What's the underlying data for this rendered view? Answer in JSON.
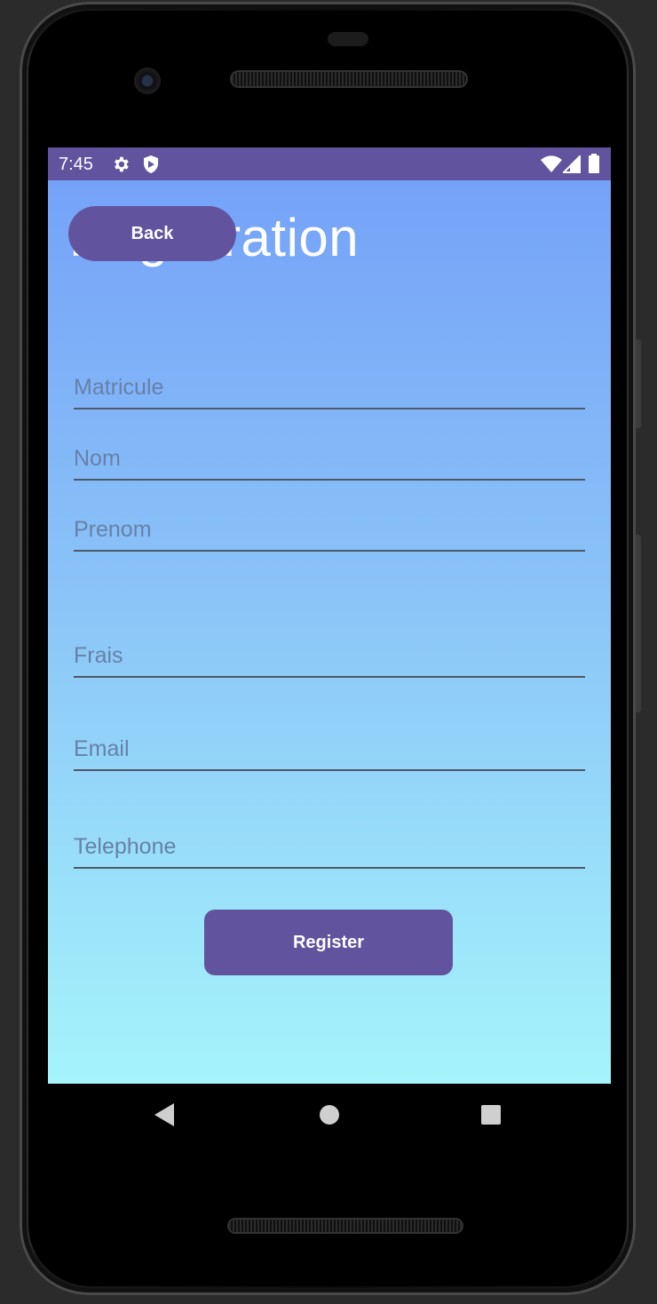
{
  "status_bar": {
    "time": "7:45",
    "icons": [
      "gear-icon",
      "shield-icon",
      "wifi-icon",
      "signal-icon",
      "battery-icon"
    ]
  },
  "header": {
    "title": "Registration",
    "back_label": "Back"
  },
  "form": {
    "matricule_placeholder": "Matricule",
    "nom_placeholder": "Nom",
    "prenom_placeholder": "Prenom",
    "frais_placeholder": "Frais",
    "email_placeholder": "Email",
    "telephone_placeholder": "Telephone",
    "register_label": "Register"
  },
  "nav": {
    "items": [
      "back-triangle-icon",
      "home-circle-icon",
      "recents-square-icon"
    ]
  },
  "colors": {
    "accent": "#62539f",
    "gradient_top": "#75a2f8",
    "gradient_bottom": "#a5f4fb"
  }
}
